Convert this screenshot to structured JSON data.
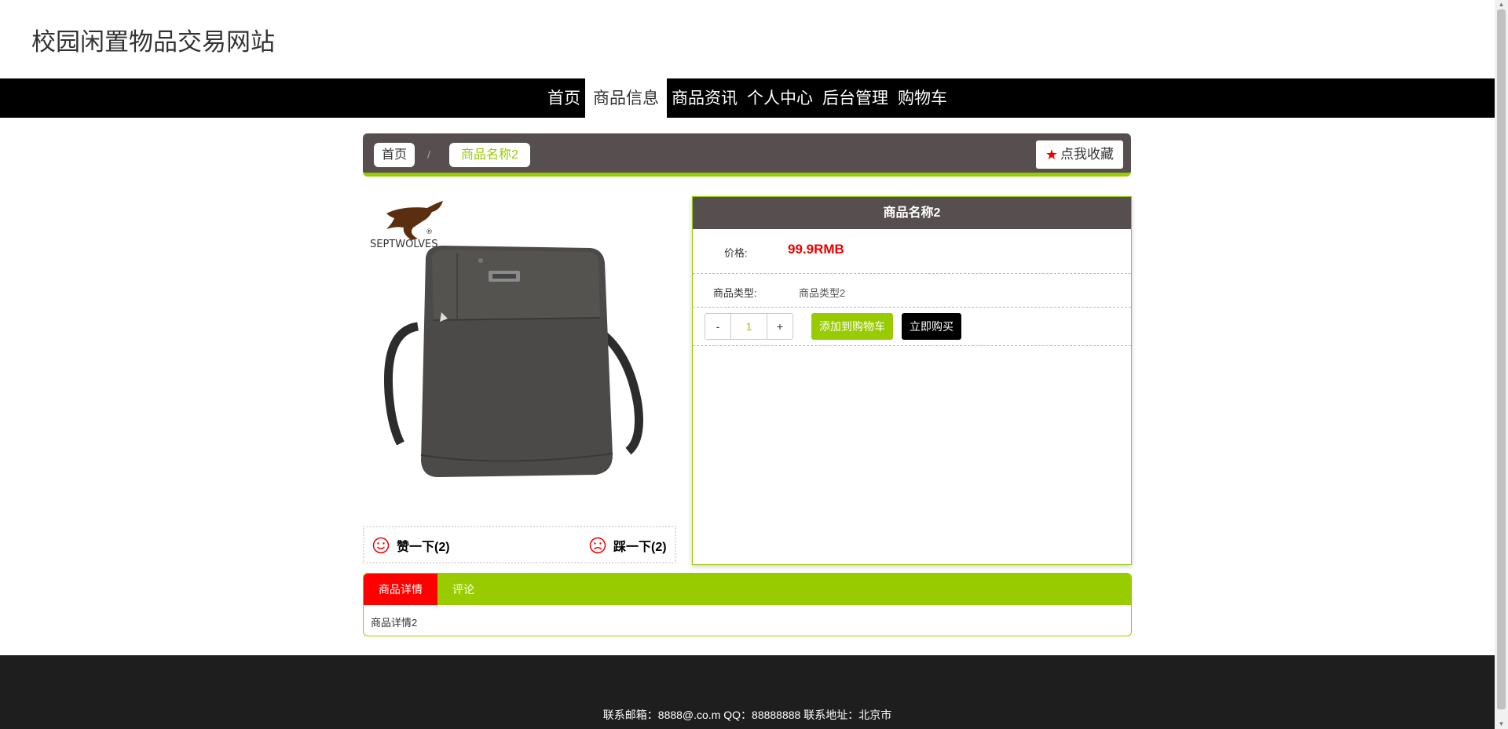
{
  "site": {
    "title": "校园闲置物品交易网站"
  },
  "nav": {
    "items": [
      "首页",
      "商品信息",
      "商品资讯",
      "个人中心",
      "后台管理",
      "购物车"
    ]
  },
  "breadcrumb": {
    "home": "首页",
    "separator": "/",
    "current": "商品名称2"
  },
  "favorite": {
    "label": "点我收藏",
    "icon": "star-icon"
  },
  "product": {
    "brand_logo_text": "SEPTWOLVES",
    "name": "商品名称2",
    "price_label": "价格:",
    "price": "99.9RMB",
    "type_label": "商品类型:",
    "type_value": "商品类型2",
    "quantity": "1",
    "minus": "-",
    "plus": "+",
    "add_to_cart": "添加到购物车",
    "buy_now": "立即购买"
  },
  "votes": {
    "like_label": "赞一下(2)",
    "dislike_label": "踩一下(2)"
  },
  "tabs": {
    "items": [
      "商品详情",
      "评论"
    ],
    "active": "商品详情",
    "content": "商品详情2"
  },
  "footer": {
    "text": "联系邮箱：8888@.co.m QQ：88888888 联系地址：北京市"
  },
  "colors": {
    "accent": "#99cc00",
    "dark_panel": "#574f4f",
    "price": "#ee0000",
    "active_tab": "#ff0000",
    "nav_bg": "#000000",
    "footer_bg": "#1e1e1e"
  }
}
